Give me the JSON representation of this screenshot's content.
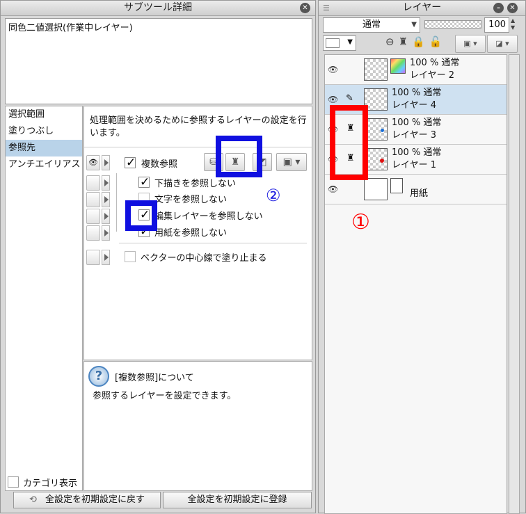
{
  "left_panel": {
    "title": "サブツール詳細",
    "tool_name": "同色二値選択(作業中レイヤー)",
    "categories": [
      "選択範囲",
      "塗りつぶし",
      "参照先",
      "アンチエイリアス"
    ],
    "description": "処理範囲を決めるために参照するレイヤーの設定を行います。",
    "multi_ref_label": "複数参照",
    "options": [
      "下描きを参照しない",
      "文字を参照しない",
      "編集レイヤーを参照しない",
      "用紙を参照しない"
    ],
    "vector_label": "ベクターの中心線で塗り止まる",
    "help_title": "[複数参照]について",
    "help_text": "参照するレイヤーを設定できます。",
    "category_toggle": "カテゴリ表示",
    "reset_button": "全設定を初期設定に戻す",
    "register_button": "全設定を初期設定に登録"
  },
  "layer_panel": {
    "title": "レイヤー",
    "blend_mode": "通常",
    "opacity": "100",
    "layers": [
      {
        "percent": "100 % 通常",
        "name": "レイヤー 2"
      },
      {
        "percent": "100 % 通常",
        "name": "レイヤー 4"
      },
      {
        "percent": "100 % 通常",
        "name": "レイヤー 3"
      },
      {
        "percent": "100 % 通常",
        "name": "レイヤー 1"
      },
      {
        "percent": "",
        "name": "用紙"
      }
    ]
  },
  "annotations": {
    "circle1": "①",
    "circle2": "②"
  },
  "colors": {
    "red_box": "#ff0000",
    "blue_box": "#1010e0",
    "selected": "#b9d3e9"
  }
}
